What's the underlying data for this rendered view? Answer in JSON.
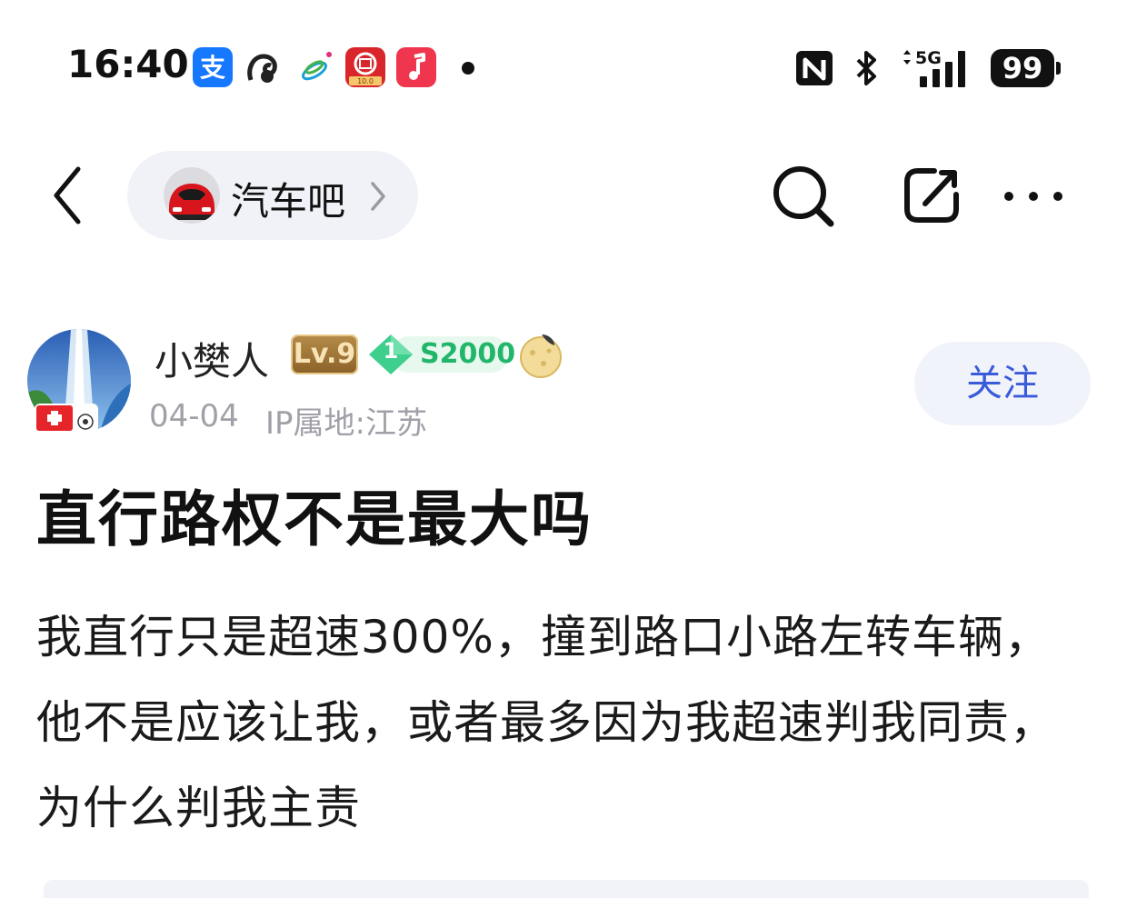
{
  "status_bar": {
    "time": "16:40",
    "notification_icons": [
      "alipay-icon",
      "squirrel-app-icon",
      "china-mobile-icon",
      "bank-app-icon",
      "music-app-icon"
    ],
    "bank_app_badge": "10.0",
    "alipay_glyph": "支",
    "network_label": "5G",
    "battery": "99"
  },
  "nav": {
    "forum_name": "汽车吧"
  },
  "author": {
    "name": "小樊人",
    "level": "Lv.9",
    "badge_rank": "1",
    "badge_label": "S2000",
    "date": "04-04",
    "ip_location": "IP属地:江苏",
    "follow_label": "关注"
  },
  "post": {
    "title": "直行路权不是最大吗",
    "content": "我直行只是超速300%，撞到路口小路左转车辆，他不是应该让我，或者最多因为我超速判我同责，为什么判我主责"
  },
  "colors": {
    "accent": "#3a5bd9",
    "chip_bg": "#f1f2f7",
    "meta_text": "#a0a0a8",
    "badge_green": "#22b66a"
  }
}
